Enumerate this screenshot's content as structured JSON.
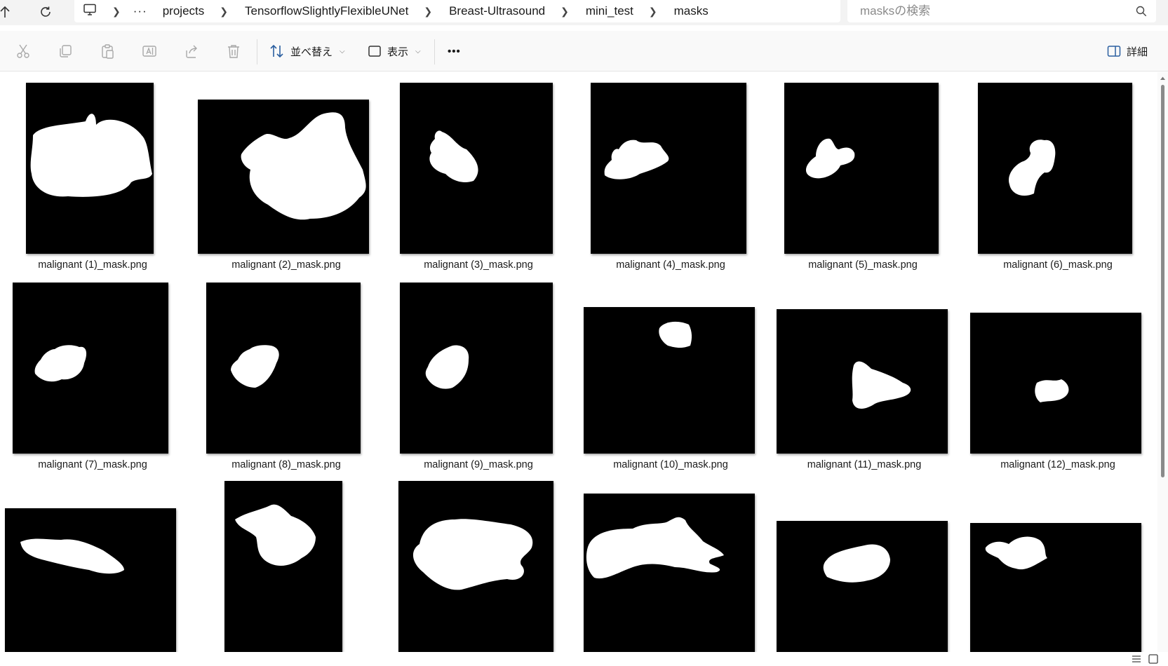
{
  "window": {
    "breadcrumb": [
      "projects",
      "TensorflowSlightlyFlexibleUNet",
      "Breast-Ultrasound",
      "mini_test",
      "masks"
    ],
    "more_label": "···",
    "search_placeholder": "masksの検索"
  },
  "toolbar": {
    "sort_label": "並べ替え",
    "view_label": "表示",
    "more_label": "•••",
    "details_label": "詳細"
  },
  "files": [
    {
      "name": "malignant (1)_mask.png"
    },
    {
      "name": "malignant (2)_mask.png"
    },
    {
      "name": "malignant (3)_mask.png"
    },
    {
      "name": "malignant (4)_mask.png"
    },
    {
      "name": "malignant (5)_mask.png"
    },
    {
      "name": "malignant (6)_mask.png"
    },
    {
      "name": "malignant (7)_mask.png"
    },
    {
      "name": "malignant (8)_mask.png"
    },
    {
      "name": "malignant (9)_mask.png"
    },
    {
      "name": "malignant (10)_mask.png"
    },
    {
      "name": "malignant (11)_mask.png"
    },
    {
      "name": "malignant (12)_mask.png"
    },
    {
      "name": ""
    },
    {
      "name": ""
    },
    {
      "name": ""
    },
    {
      "name": ""
    },
    {
      "name": ""
    },
    {
      "name": ""
    }
  ],
  "colors": {
    "thumbnail_bg": "#000000",
    "mask_fg": "#ffffff",
    "accent": "#0067c0"
  }
}
